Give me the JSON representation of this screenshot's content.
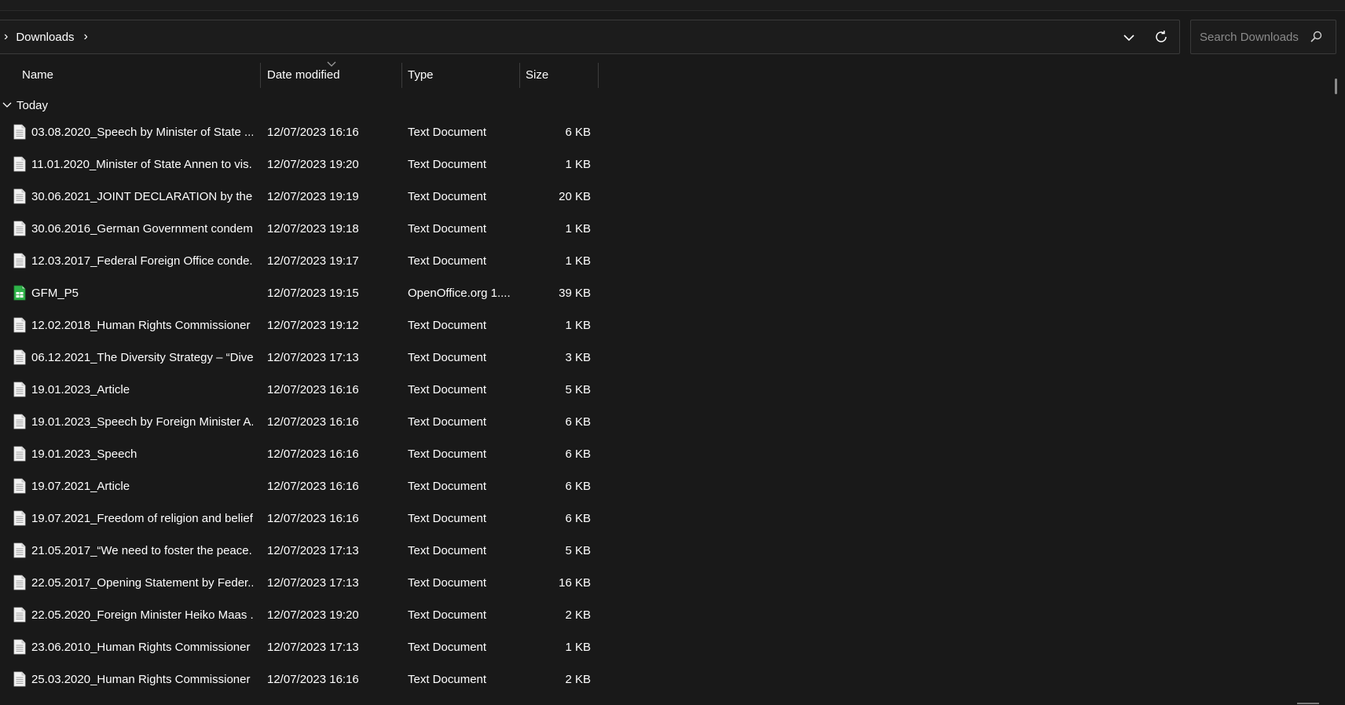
{
  "address": {
    "current_folder": "Downloads"
  },
  "search": {
    "placeholder": "Search Downloads"
  },
  "columns": {
    "name": "Name",
    "date": "Date modified",
    "type": "Type",
    "size": "Size"
  },
  "group": {
    "label": "Today"
  },
  "files": [
    {
      "name": "03.08.2020_Speech by Minister of State ...",
      "date": "12/07/2023 16:16",
      "type": "Text Document",
      "size": "6 KB",
      "icon": "text-file-icon"
    },
    {
      "name": "11.01.2020_Minister of State Annen to vis...",
      "date": "12/07/2023 19:20",
      "type": "Text Document",
      "size": "1 KB",
      "icon": "text-file-icon"
    },
    {
      "name": "30.06.2021_JOINT DECLARATION by the S...",
      "date": "12/07/2023 19:19",
      "type": "Text Document",
      "size": "20 KB",
      "icon": "text-file-icon"
    },
    {
      "name": "30.06.2016_German Government condem...",
      "date": "12/07/2023 19:18",
      "type": "Text Document",
      "size": "1 KB",
      "icon": "text-file-icon"
    },
    {
      "name": "12.03.2017_Federal Foreign Office conde...",
      "date": "12/07/2023 19:17",
      "type": "Text Document",
      "size": "1 KB",
      "icon": "text-file-icon"
    },
    {
      "name": "GFM_P5",
      "date": "12/07/2023 19:15",
      "type": "OpenOffice.org 1....",
      "size": "39 KB",
      "icon": "spreadsheet-file-icon"
    },
    {
      "name": "12.02.2018_Human Rights Commissioner ...",
      "date": "12/07/2023 19:12",
      "type": "Text Document",
      "size": "1 KB",
      "icon": "text-file-icon"
    },
    {
      "name": "06.12.2021_The Diversity Strategy – “Dive...",
      "date": "12/07/2023 17:13",
      "type": "Text Document",
      "size": "3 KB",
      "icon": "text-file-icon"
    },
    {
      "name": "19.01.2023_Article",
      "date": "12/07/2023 16:16",
      "type": "Text Document",
      "size": "5 KB",
      "icon": "text-file-icon"
    },
    {
      "name": "19.01.2023_Speech by Foreign Minister A...",
      "date": "12/07/2023 16:16",
      "type": "Text Document",
      "size": "6 KB",
      "icon": "text-file-icon"
    },
    {
      "name": "19.01.2023_Speech",
      "date": "12/07/2023 16:16",
      "type": "Text Document",
      "size": "6 KB",
      "icon": "text-file-icon"
    },
    {
      "name": "19.07.2021_Article",
      "date": "12/07/2023 16:16",
      "type": "Text Document",
      "size": "6 KB",
      "icon": "text-file-icon"
    },
    {
      "name": "19.07.2021_Freedom of religion and belief",
      "date": "12/07/2023 16:16",
      "type": "Text Document",
      "size": "6 KB",
      "icon": "text-file-icon"
    },
    {
      "name": "21.05.2017_“We need to foster the peace...",
      "date": "12/07/2023 17:13",
      "type": "Text Document",
      "size": "5 KB",
      "icon": "text-file-icon"
    },
    {
      "name": "22.05.2017_Opening Statement by Feder...",
      "date": "12/07/2023 17:13",
      "type": "Text Document",
      "size": "16 KB",
      "icon": "text-file-icon"
    },
    {
      "name": "22.05.2020_Foreign Minister Heiko Maas ...",
      "date": "12/07/2023 19:20",
      "type": "Text Document",
      "size": "2 KB",
      "icon": "text-file-icon"
    },
    {
      "name": "23.06.2010_Human Rights Commissioner ...",
      "date": "12/07/2023 17:13",
      "type": "Text Document",
      "size": "1 KB",
      "icon": "text-file-icon"
    },
    {
      "name": "25.03.2020_Human Rights Commissioner ...",
      "date": "12/07/2023 16:16",
      "type": "Text Document",
      "size": "2 KB",
      "icon": "text-file-icon"
    }
  ]
}
